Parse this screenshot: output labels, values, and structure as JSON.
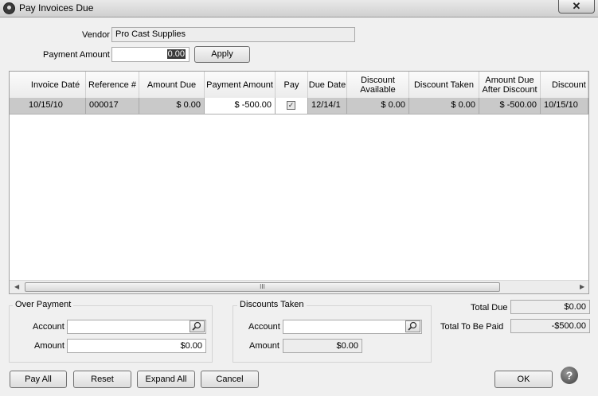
{
  "window": {
    "title": "Pay Invoices Due",
    "close_label": "✕"
  },
  "vendor": {
    "label": "Vendor",
    "value": "Pro Cast Supplies"
  },
  "payment_amount": {
    "label": "Payment Amount",
    "value_prefix": "",
    "value_selected": "0.00"
  },
  "apply_label": "Apply",
  "grid": {
    "columns": [
      "Invoice Date",
      "Reference #",
      "Amount Due",
      "Payment Amount",
      "Pay",
      "Due Date",
      "Discount Available",
      "Discount Taken",
      "Amount Due After Discount",
      "Discount"
    ],
    "rows": [
      {
        "invoice_date": "10/15/10",
        "reference": "000017",
        "amount_due": "$ 0.00",
        "payment_amount": "$ -500.00",
        "pay": true,
        "due_date": "12/14/1",
        "discount_available": "$ 0.00",
        "discount_taken": "$ 0.00",
        "amount_due_after_discount": "$ -500.00",
        "discount": "10/15/10"
      }
    ],
    "scroll_thumb_grip": "III"
  },
  "over_payment": {
    "title": "Over Payment",
    "account_label": "Account",
    "account_value": "",
    "amount_label": "Amount",
    "amount_value": "$0.00"
  },
  "discounts_taken": {
    "title": "Discounts Taken",
    "account_label": "Account",
    "account_value": "",
    "amount_label": "Amount",
    "amount_value": "$0.00"
  },
  "totals": {
    "total_due_label": "Total Due",
    "total_due_value": "$0.00",
    "total_paid_label": "Total To Be Paid",
    "total_paid_value": "-$500.00"
  },
  "buttons": {
    "pay_all": "Pay All",
    "reset": "Reset",
    "expand_all": "Expand All",
    "cancel": "Cancel",
    "ok": "OK"
  },
  "help_glyph": "?"
}
